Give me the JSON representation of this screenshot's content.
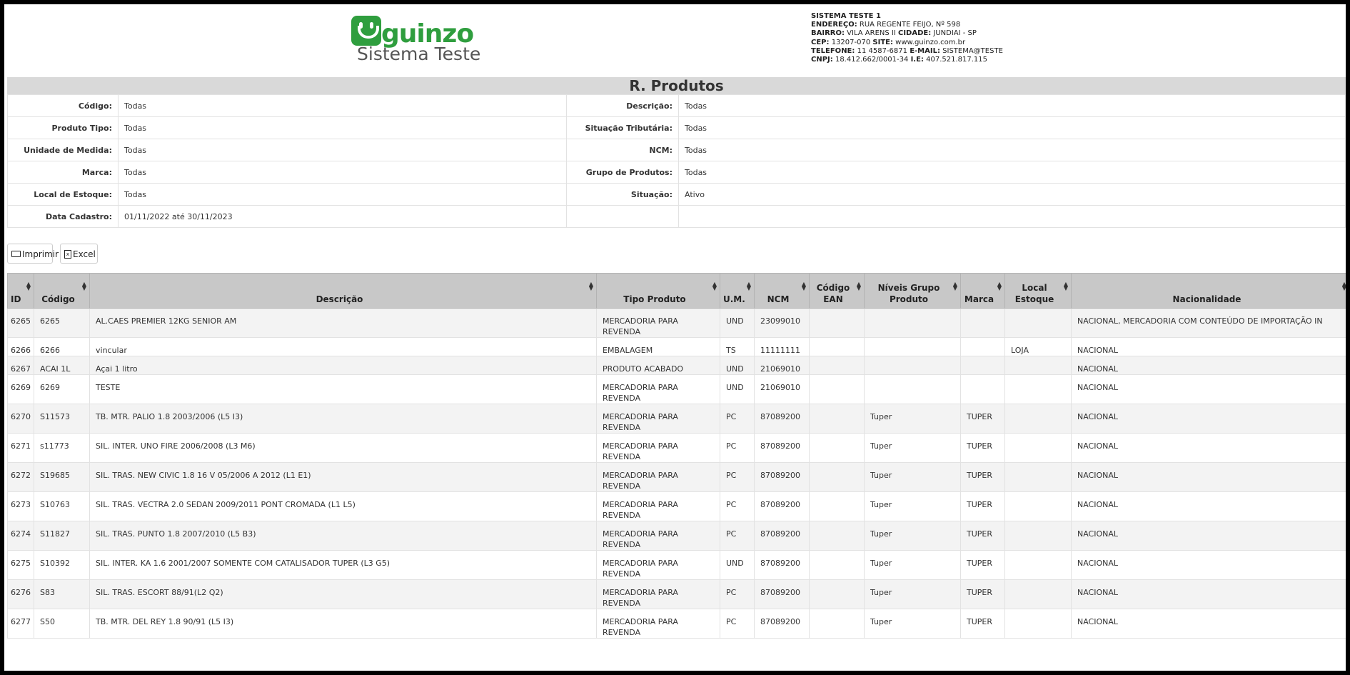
{
  "header": {
    "logo": {
      "brand": "guinzo",
      "subtitle": "Sistema Teste"
    },
    "company_lines": [
      {
        "label": "",
        "value": "SISTEMA TESTE 1"
      },
      {
        "label": "ENDEREÇO:",
        "value": "RUA REGENTE FEIJO, Nº 598"
      },
      {
        "label": "BAIRRO:",
        "value": "VILA ARENS II",
        "label2": "CIDADE:",
        "value2": "JUNDIAI - SP"
      },
      {
        "label": "CEP:",
        "value": "13207-070",
        "label2": "SITE:",
        "value2": "www.guinzo.com.br"
      },
      {
        "label": "TELEFONE:",
        "value": "11 4587-6871",
        "label2": "E-MAIL:",
        "value2": "SISTEMA@TESTE"
      },
      {
        "label": "CNPJ:",
        "value": "18.412.662/0001-34",
        "label2": "I.E:",
        "value2": "407.521.817.115"
      }
    ]
  },
  "report_title": "R. Produtos",
  "filters": [
    {
      "label": "Código:",
      "value": "Todas",
      "label2": "Descrição:",
      "value2": "Todas"
    },
    {
      "label": "Produto Tipo:",
      "value": "Todas",
      "label2": "Situação Tributária:",
      "value2": "Todas"
    },
    {
      "label": "Unidade de Medida:",
      "value": "Todas",
      "label2": "NCM:",
      "value2": "Todas"
    },
    {
      "label": "Marca:",
      "value": "Todas",
      "label2": "Grupo de Produtos:",
      "value2": "Todas"
    },
    {
      "label": "Local de Estoque:",
      "value": "Todas",
      "label2": "Situação:",
      "value2": "Ativo"
    },
    {
      "label": "Data Cadastro:",
      "value": "01/11/2022 até 30/11/2023",
      "label2": "",
      "value2": ""
    }
  ],
  "buttons": {
    "print": "Imprimir",
    "excel": "Excel"
  },
  "columns": [
    "ID",
    "Código",
    "Descrição",
    "Tipo Produto",
    "U.M.",
    "NCM",
    "Código EAN",
    "Níveis Grupo Produto",
    "Marca",
    "Local Estoque",
    "Nacionalidade"
  ],
  "rows": [
    [
      "6265",
      "6265",
      "AL.CAES PREMIER 12KG SENIOR AM",
      "MERCADORIA PARA REVENDA",
      "UND",
      "23099010",
      "",
      "",
      "",
      "",
      "NACIONAL, MERCADORIA COM CONTEÚDO DE IMPORTAÇÃO IN"
    ],
    [
      "6266",
      "6266",
      "vincular",
      "EMBALAGEM",
      "TS",
      "11111111",
      "",
      "",
      "",
      "LOJA",
      "NACIONAL"
    ],
    [
      "6267",
      "ACAI 1L",
      "Açai 1 litro",
      "PRODUTO ACABADO",
      "UND",
      "21069010",
      "",
      "",
      "",
      "",
      "NACIONAL"
    ],
    [
      "6269",
      "6269",
      "TESTE",
      "MERCADORIA PARA REVENDA",
      "UND",
      "21069010",
      "",
      "",
      "",
      "",
      "NACIONAL"
    ],
    [
      "6270",
      "S11573",
      "TB. MTR. PALIO 1.8 2003/2006 (L5 I3)",
      "MERCADORIA PARA REVENDA",
      "PC",
      "87089200",
      "",
      "Tuper",
      "TUPER",
      "",
      "NACIONAL"
    ],
    [
      "6271",
      "s11773",
      "SIL. INTER. UNO FIRE 2006/2008 (L3 M6)",
      "MERCADORIA PARA REVENDA",
      "PC",
      "87089200",
      "",
      "Tuper",
      "TUPER",
      "",
      "NACIONAL"
    ],
    [
      "6272",
      "S19685",
      "SIL. TRAS. NEW CIVIC 1.8 16 V 05/2006 A 2012 (L1 E1)",
      "MERCADORIA PARA REVENDA",
      "PC",
      "87089200",
      "",
      "Tuper",
      "TUPER",
      "",
      "NACIONAL"
    ],
    [
      "6273",
      "S10763",
      "SIL. TRAS. VECTRA 2.0 SEDAN 2009/2011 PONT CROMADA (L1 L5)",
      "MERCADORIA PARA REVENDA",
      "PC",
      "87089200",
      "",
      "Tuper",
      "TUPER",
      "",
      "NACIONAL"
    ],
    [
      "6274",
      "S11827",
      "SIL. TRAS. PUNTO 1.8 2007/2010 (L5 B3)",
      "MERCADORIA PARA REVENDA",
      "PC",
      "87089200",
      "",
      "Tuper",
      "TUPER",
      "",
      "NACIONAL"
    ],
    [
      "6275",
      "S10392",
      "SIL. INTER. KA 1.6 2001/2007 SOMENTE COM CATALISADOR TUPER (L3 G5)",
      "MERCADORIA PARA REVENDA",
      "UND",
      "87089200",
      "",
      "Tuper",
      "TUPER",
      "",
      "NACIONAL"
    ],
    [
      "6276",
      "S83",
      "SIL. TRAS. ESCORT 88/91(L2 Q2)",
      "MERCADORIA PARA REVENDA",
      "PC",
      "87089200",
      "",
      "Tuper",
      "TUPER",
      "",
      "NACIONAL"
    ],
    [
      "6277",
      "S50",
      "TB. MTR. DEL REY 1.8 90/91 (L5 I3)",
      "MERCADORIA PARA REVENDA",
      "PC",
      "87089200",
      "",
      "Tuper",
      "TUPER",
      "",
      "NACIONAL"
    ]
  ]
}
